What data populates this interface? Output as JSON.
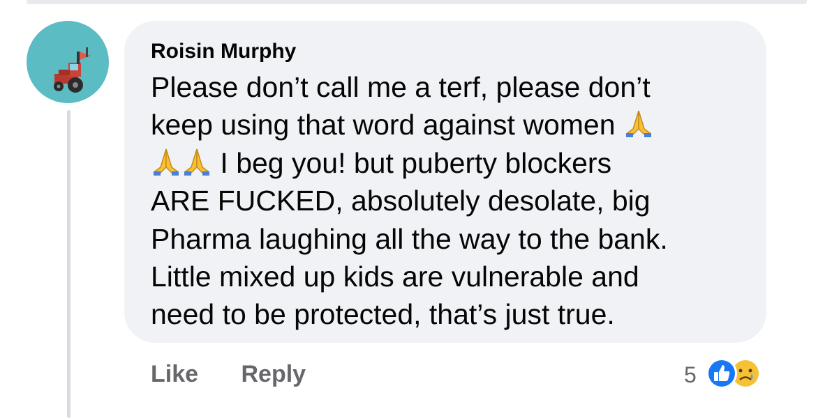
{
  "comment": {
    "author": "Roisin Murphy",
    "lines": [
      "Please don’t call me a terf, please don’t",
      "keep using that word against women",
      "I beg you! but puberty blockers",
      "ARE FUCKED, absolutely desolate, big",
      "Pharma laughing all the way to the bank.",
      "Little mixed up kids are vulnerable and",
      "need to be protected, that’s just true."
    ]
  },
  "actions": {
    "like_label": "Like",
    "reply_label": "Reply"
  },
  "reactions": {
    "count": "5",
    "icons": [
      "like-reaction-icon",
      "sad-reaction-icon"
    ]
  },
  "icons": {
    "avatar": "tractor-avatar",
    "inline_emoji": "folded-hands-icon"
  },
  "colors": {
    "bubble_bg": "#f0f2f5",
    "avatar_bg": "#5cbcc4",
    "text": "#050505",
    "muted": "#65676b",
    "like_blue": "#1877f2",
    "emoji_yellow": "#f7c136"
  }
}
